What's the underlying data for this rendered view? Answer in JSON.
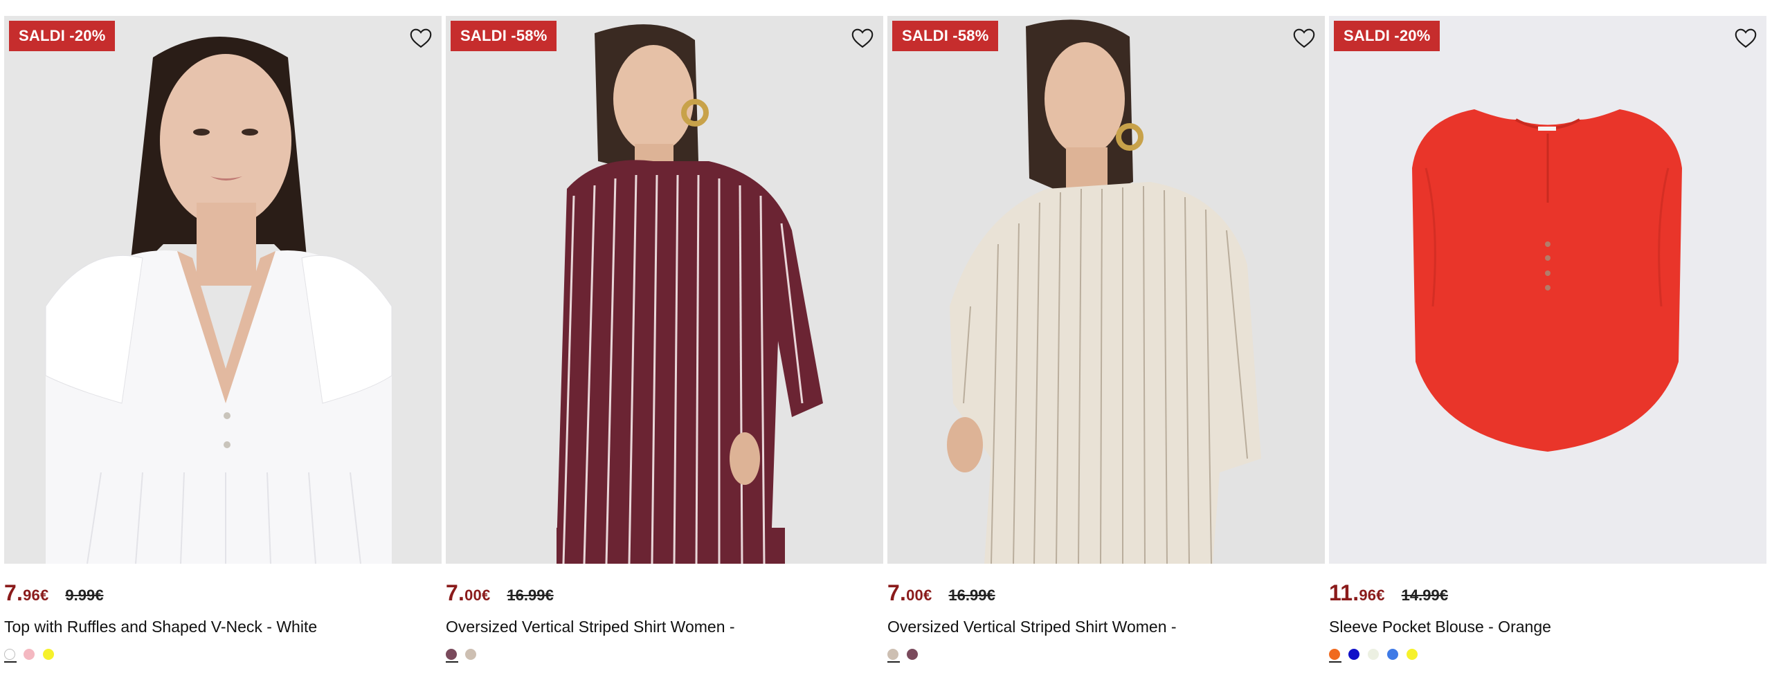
{
  "products": [
    {
      "badge": "SALDI -20%",
      "price_int": "7",
      "price_dec": "96€",
      "price_old": "9.99€",
      "title": "Top with Ruffles and Shaped V-Neck - White",
      "swatches": [
        "#ffffff",
        "#f4b8c1",
        "#f6f12b"
      ]
    },
    {
      "badge": "SALDI -58%",
      "price_int": "7",
      "price_dec": "00€",
      "price_old": "16.99€",
      "title": "Oversized Vertical Striped Shirt Women -",
      "swatches": [
        "#7a4a5c",
        "#cdbfb2"
      ]
    },
    {
      "badge": "SALDI -58%",
      "price_int": "7",
      "price_dec": "00€",
      "price_old": "16.99€",
      "title": "Oversized Vertical Striped Shirt Women -",
      "swatches": [
        "#cdbfb2",
        "#7a4a5c"
      ]
    },
    {
      "badge": "SALDI -20%",
      "price_int": "11",
      "price_dec": "96€",
      "price_old": "14.99€",
      "title": "Sleeve Pocket Blouse - Orange",
      "swatches": [
        "#f06a1f",
        "#1010c8",
        "#ecf0e2",
        "#3f7ae6",
        "#f6f12b"
      ]
    }
  ],
  "colors": {
    "badge_bg": "#c62d2d",
    "price_now": "#8a1b1b"
  },
  "icons": {
    "favorite": "heart-outline-icon"
  }
}
